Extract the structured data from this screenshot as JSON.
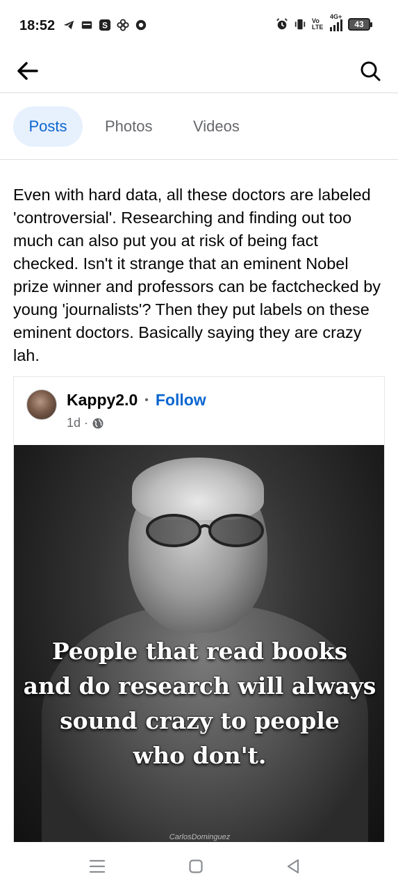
{
  "status_bar": {
    "time": "18:52",
    "battery": "43",
    "left_icons": [
      "telegram-icon",
      "wallet-icon",
      "s-app-icon",
      "pinwheel-icon",
      "chrome-icon"
    ],
    "right_icons": [
      "alarm-icon",
      "vibrate-icon",
      "volte-icon",
      "signal-4g-icon",
      "battery-icon"
    ],
    "volte_label": "Vo LTE",
    "network_label": "4G+"
  },
  "top_nav": {
    "back_icon": "arrow-left-icon",
    "search_icon": "search-icon"
  },
  "tabs": [
    {
      "label": "Posts",
      "active": true
    },
    {
      "label": "Photos",
      "active": false
    },
    {
      "label": "Videos",
      "active": false
    }
  ],
  "post": {
    "text": "Even with hard data, all these doctors are labeled 'controversial'. Researching and finding out too much can also put you at risk of being fact checked. Isn't it strange that an eminent Nobel prize winner and professors can be factchecked by young 'journalists'? Then they put labels on these eminent doctors. Basically saying they are crazy lah."
  },
  "shared_post": {
    "author": "Kappy2.0",
    "separator": "•",
    "follow_label": "Follow",
    "time": "1d",
    "meta_separator": "·",
    "privacy_icon": "globe-icon",
    "image_quote_lines": [
      "People that read books",
      "and do research will always",
      "sound crazy to people",
      "who don't."
    ],
    "image_watermark": "CarlosDominguez"
  },
  "bottom_nav": {
    "icons": [
      "menu-icon",
      "home-square-icon",
      "back-triangle-icon"
    ]
  },
  "colors": {
    "accent": "#0a66d0",
    "active_tab_bg": "#e7f0fd",
    "secondary_text": "#65676b",
    "divider": "#dcdde0"
  }
}
